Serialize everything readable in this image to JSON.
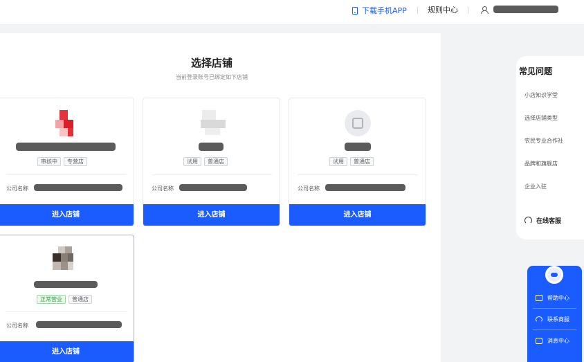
{
  "topbar": {
    "download_app": "下载手机APP",
    "rules_center": "规则中心"
  },
  "main": {
    "title": "选择店铺",
    "subtitle": "当前登录账号已绑定如下店铺"
  },
  "stores": [
    {
      "tags": [
        "审核中",
        "专营店"
      ],
      "tag_style": [
        "gray",
        "gray"
      ],
      "company_label": "公司名称",
      "enter_label": "进入店铺"
    },
    {
      "tags": [
        "试用",
        "普通店"
      ],
      "tag_style": [
        "gray",
        "gray"
      ],
      "company_label": "公司名称",
      "enter_label": "进入店铺"
    },
    {
      "tags": [
        "试用",
        "普通店"
      ],
      "tag_style": [
        "gray",
        "gray"
      ],
      "company_label": "公司名称",
      "enter_label": "进入店铺"
    },
    {
      "tags": [
        "正常营业",
        "普通店"
      ],
      "tag_style": [
        "green",
        "gray"
      ],
      "company_label": "公司名称",
      "enter_label": "进入店铺"
    }
  ],
  "faq": {
    "title": "常见问题",
    "items": [
      "小店知识学堂",
      "选择店铺类型",
      "农民专业合作社",
      "品牌和旗舰店",
      "企业入驻"
    ],
    "online_service": "在线客服"
  },
  "help_widget": {
    "items": [
      {
        "label": "帮助中心",
        "icon": "help-center-icon"
      },
      {
        "label": "联系商服",
        "icon": "headset-icon"
      },
      {
        "label": "消息中心",
        "icon": "message-icon"
      }
    ]
  },
  "colors": {
    "accent": "#1a5cff",
    "status_green": "#22a33a"
  }
}
